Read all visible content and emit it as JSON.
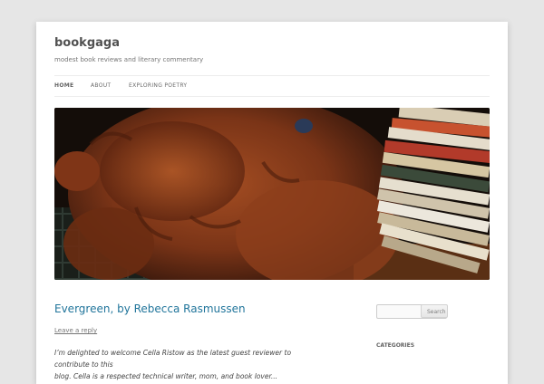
{
  "header": {
    "site_title": "bookgaga",
    "site_description": "modest book reviews and literary commentary"
  },
  "nav": {
    "items": [
      {
        "label": "HOME",
        "current": true
      },
      {
        "label": "ABOUT",
        "current": false
      },
      {
        "label": "EXPLORING POETRY",
        "current": false
      }
    ]
  },
  "header_image": {
    "subject": "dog-sleeping-beside-stack-of-books"
  },
  "post": {
    "title": "Evergreen, by Rebecca Rasmussen",
    "reply_link": "Leave a reply",
    "excerpt_line1": "I’m delighted to welcome Cella Ristow as the latest guest reviewer to contribute to this",
    "excerpt_line2": "blog. Cella is a respected technical writer, mom, and book lover..."
  },
  "sidebar": {
    "search": {
      "placeholder": "",
      "button_label": "Search"
    },
    "categories_title": "CATEGORIES"
  },
  "colors": {
    "page_background": "#e6e6e6",
    "link_blue": "#21759b",
    "dog_fur": "#8a3e1c"
  }
}
